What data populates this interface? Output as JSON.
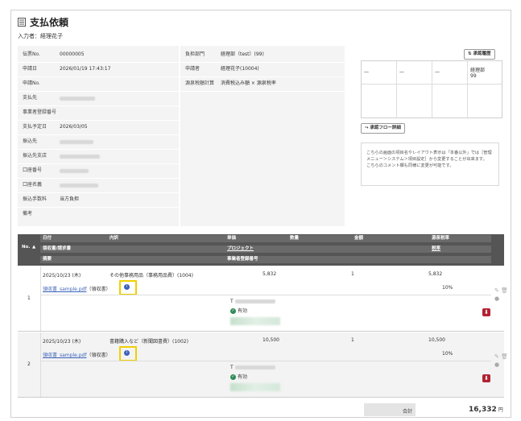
{
  "header": {
    "title": "支払依頼",
    "inputter": "入力者：経理花子"
  },
  "left_fields": [
    {
      "label": "伝票No.",
      "value": "00000005"
    },
    {
      "label": "申請日",
      "value": "2026/01/19 17:43:17"
    },
    {
      "label": "申請No.",
      "value": ""
    },
    {
      "label": "支払先",
      "value": ""
    },
    {
      "label": "事業者登録番号",
      "value": ""
    },
    {
      "label": "支払予定日",
      "value": "2026/03/05"
    },
    {
      "label": "振込先",
      "value": ""
    },
    {
      "label": "振込先支店",
      "value": ""
    },
    {
      "label": "口座番号",
      "value": ""
    },
    {
      "label": "口座名義",
      "value": ""
    },
    {
      "label": "振込手数料",
      "value": "当方負担"
    },
    {
      "label": "備考",
      "value": ""
    }
  ],
  "mid_fields": [
    {
      "label": "負担部門",
      "value": "経理部（test）(99)"
    },
    {
      "label": "申請者",
      "value": "経理花子(10004)"
    },
    {
      "label": "源泉税額計算",
      "value": "消費税込み額 × 源泉税率"
    }
  ],
  "approval": {
    "history_button": "承認履歴",
    "flow_button": "承認フロー詳細",
    "cells": [
      "—",
      "—",
      "—",
      "経理部\n99"
    ]
  },
  "note": "こちらの画面の項目名やレイアウト表示は「本番以外」では［管理メニュー＞システム＞項目設定］から変更することが出来ます。\nこちらのコメント欄も同様に変更が可能です。",
  "table": {
    "headers": {
      "no": "No.",
      "date": "日付",
      "content": "内訳",
      "unit_price": "単価",
      "qty": "数量",
      "amount": "金額",
      "tax_rate": "源泉税率",
      "receipt": "領収書/請求書",
      "project": "プロジェクト",
      "tax": "税率",
      "summary": "摘要",
      "reg_no": "事業者登録番号"
    },
    "sort_icon": "▲",
    "rows": [
      {
        "no": "1",
        "date": "2025/10/23 (木)",
        "content": "その他事務用品（事務用品費）(1004)",
        "unit_price": "5,832",
        "qty": "1",
        "amount": "5,832",
        "receipt": "領収書_sample.pdf",
        "receipt_type": "（領収書）",
        "tax": "10%",
        "reg_prefix": "T",
        "valid": "有効"
      },
      {
        "no": "2",
        "date": "2025/10/23 (木)",
        "content": "書籍購入など（新聞図書費）(1002)",
        "unit_price": "10,500",
        "qty": "1",
        "amount": "10,500",
        "receipt": "領収書_sample.pdf",
        "receipt_type": "（領収書）",
        "tax": "10%",
        "reg_prefix": "T",
        "valid": "有効"
      }
    ],
    "total_label": "合計",
    "total_value": "16,332",
    "total_unit": "円"
  }
}
